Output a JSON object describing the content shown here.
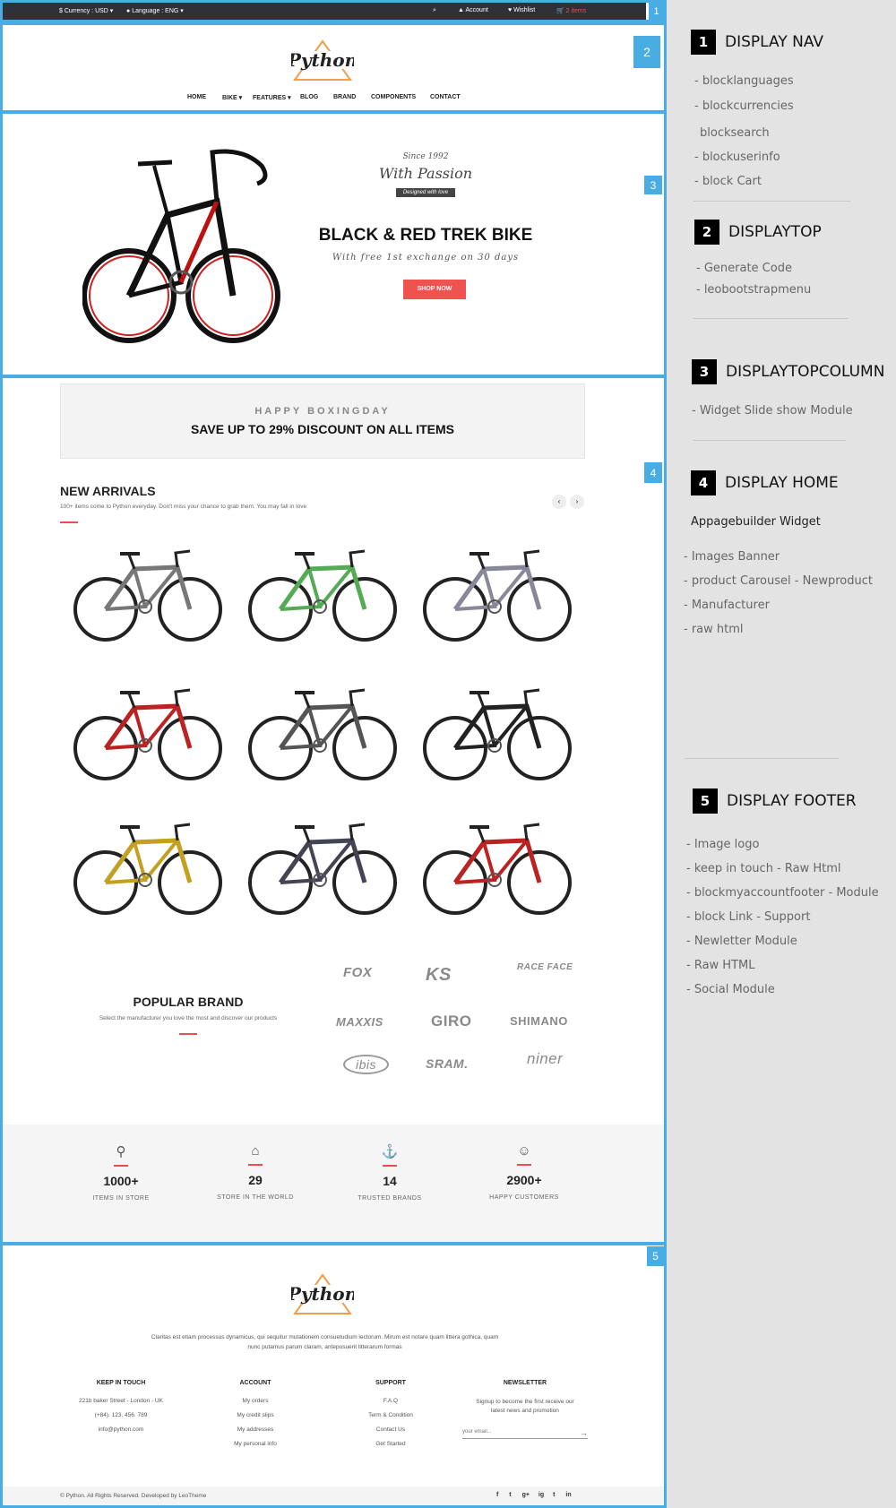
{
  "topbar": {
    "currency": "Currency : USD",
    "language": "Language : ENG",
    "account": "Account",
    "wishlist": "Wishlist",
    "cart": "2 items",
    "marker": "1"
  },
  "header": {
    "logo_text": "Python",
    "marker": "2",
    "nav": [
      "HOME",
      "BIKE",
      "FEATURES",
      "BLOG",
      "BRAND",
      "COMPONENTS",
      "CONTACT"
    ]
  },
  "slider": {
    "marker": "3",
    "since": "Since 1992",
    "passion": "With Passion",
    "ribbon": "Designed with love",
    "title": "BLACK & RED TREK BIKE",
    "subtitle": "With free 1st exchange on 30 days",
    "button": "SHOP NOW"
  },
  "home": {
    "marker": "4",
    "banner_small": "HAPPY BOXINGDAY",
    "banner_big": "SAVE UP TO 29% DISCOUNT ON ALL ITEMS",
    "arrivals_title": "NEW ARRIVALS",
    "arrivals_desc": "100+ items come to Python everyday. Don't miss your chance to grab them. You may fall in love",
    "brand_title": "POPULAR BRAND",
    "brand_desc": "Select the manufacturer you love the most and discover our products",
    "brands": [
      "FOX",
      "KS",
      "RACE FACE",
      "MAXXIS",
      "GIRO",
      "SHIMANO",
      "ibis",
      "SRAM.",
      "niner"
    ]
  },
  "stats": [
    {
      "number": "1000+",
      "label": "ITEMS IN STORE",
      "icon": "bicycle-icon"
    },
    {
      "number": "29",
      "label": "STORE IN THE WORLD",
      "icon": "home-icon"
    },
    {
      "number": "14",
      "label": "TRUSTED BRANDS",
      "icon": "anchor-icon"
    },
    {
      "number": "2900+",
      "label": "HAPPY CUSTOMERS",
      "icon": "smile-icon"
    }
  ],
  "footer": {
    "marker": "5",
    "logo_text": "Python",
    "about": "Claritas est etiam processus dynamicus, qui sequitur mutationem consuetudium lectorum. Mirum est notare quam littera gothica, quam nunc putamus parum claram, anteposuerit litterarum formas",
    "keep": {
      "title": "KEEP IN TOUCH",
      "lines": [
        "221b baker Street - London - UK",
        "(+84). 123. 456. 789",
        "info@python.com"
      ]
    },
    "account": {
      "title": "ACCOUNT",
      "lines": [
        "My orders",
        "My credit slips",
        "My addresses",
        "My personal info"
      ]
    },
    "support": {
      "title": "SUPPORT",
      "lines": [
        "F.A.Q",
        "Term & Condition",
        "Contact Us",
        "Get Started"
      ]
    },
    "newsletter": {
      "title": "NEWSLETTER",
      "text": "Signup to become the first receive our latest news and promotion",
      "placeholder": "your email..."
    },
    "copyright": "© Python. All Rights Reserved. Developed by LeoTheme",
    "social": [
      "f",
      "t",
      "g+",
      "ig",
      "t",
      "in"
    ]
  },
  "panel": {
    "s1": {
      "num": "1",
      "title": "DISPLAY NAV",
      "items": [
        "-  blocklanguages",
        "-  blockcurrencies",
        "blocksearch",
        "-  blockuserinfo",
        "-  block Cart"
      ]
    },
    "s2": {
      "num": "2",
      "title": "DISPLAYTOP",
      "items": [
        "-  Generate Code",
        "-  leobootstrapmenu"
      ]
    },
    "s3": {
      "num": "3",
      "title": "DISPLAYTOPCOLUMN",
      "items": [
        "-  Widget  Slide show Module"
      ]
    },
    "s4": {
      "num": "4",
      "title": "DISPLAY  HOME",
      "sub": "Appagebuilder  Widget",
      "items": [
        "-  Images Banner",
        "-  product Carousel - Newproduct",
        "-   Manufacturer",
        "- raw html"
      ]
    },
    "s5": {
      "num": "5",
      "title": "DISPLAY  FOOTER",
      "items": [
        "- Image logo",
        "-  keep in touch -  Raw Html",
        "-  blockmyaccountfooter - Module",
        "-  block Link  -  Support",
        "-  Newletter Module",
        "-   Raw HTML",
        "-  Social Module"
      ]
    }
  },
  "colors": {
    "accent": "#ef4b50",
    "frame": "#49ace2",
    "topbar": "#2f3136"
  }
}
